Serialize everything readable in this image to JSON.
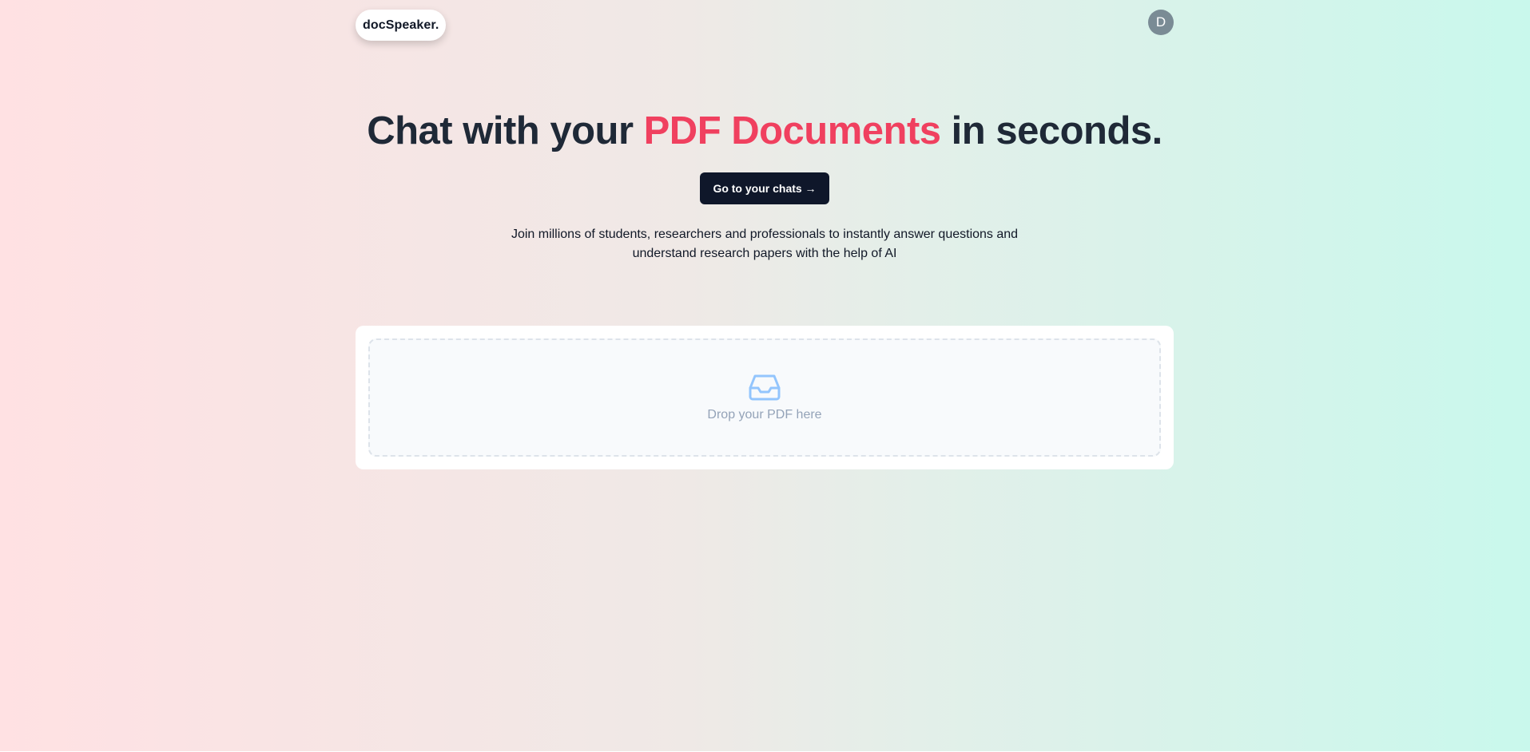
{
  "header": {
    "logo_text": "docSpeaker.",
    "avatar_initial": "D"
  },
  "hero": {
    "title_part1": "Chat with your ",
    "title_accent": "PDF Documents",
    "title_part2": " in seconds.",
    "cta_label": "Go to your chats →",
    "subtitle": "Join millions of students, researchers and professionals to instantly answer questions and understand research papers with the help of AI"
  },
  "upload": {
    "icon": "inbox-icon",
    "drop_label": "Drop your PDF here"
  },
  "colors": {
    "accent": "#f0405f",
    "button_bg": "#0f172a",
    "icon_color": "#93c5fd",
    "avatar_bg": "#7a8b95"
  }
}
